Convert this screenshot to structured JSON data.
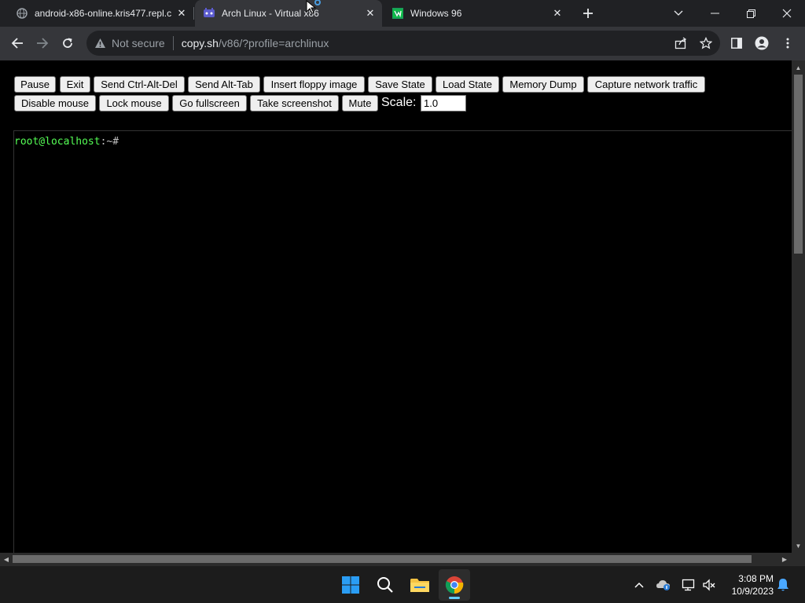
{
  "tabs": [
    {
      "title": "android-x86-online.kris477.repl.c",
      "active": false,
      "icon": "globe-icon"
    },
    {
      "title": "Arch Linux - Virtual x86",
      "active": true,
      "icon": "v86-icon"
    },
    {
      "title": "Windows 96",
      "active": false,
      "icon": "windows96-icon"
    }
  ],
  "tab_close_glyph": "✕",
  "window_controls": {
    "minimize": "—",
    "maximize": "❐",
    "close": "✕",
    "tab_search": "⌄"
  },
  "address_bar": {
    "security_label": "Not secure",
    "url_host": "copy.sh",
    "url_path": "/v86/?profile=archlinux"
  },
  "controls": {
    "row1": [
      "Pause",
      "Exit",
      "Send Ctrl-Alt-Del",
      "Send Alt-Tab",
      "Insert floppy image",
      "Save State",
      "Load State",
      "Memory Dump",
      "Capture network traffic"
    ],
    "row2": [
      "Disable mouse",
      "Lock mouse",
      "Go fullscreen",
      "Take screenshot",
      "Mute"
    ],
    "scale_label": "Scale:",
    "scale_value": "1.0"
  },
  "terminal": {
    "user_host": "root@localhost",
    "path": ":~#"
  },
  "taskbar": {
    "apps": [
      "start-icon",
      "search-icon",
      "file-explorer-icon",
      "chrome-icon"
    ],
    "time": "3:08 PM",
    "date": "10/9/2023"
  },
  "colors": {
    "tab_bar": "#202124",
    "toolbar": "#35363a",
    "prompt_green": "#55ff55",
    "taskbar": "#1c1c1c"
  }
}
